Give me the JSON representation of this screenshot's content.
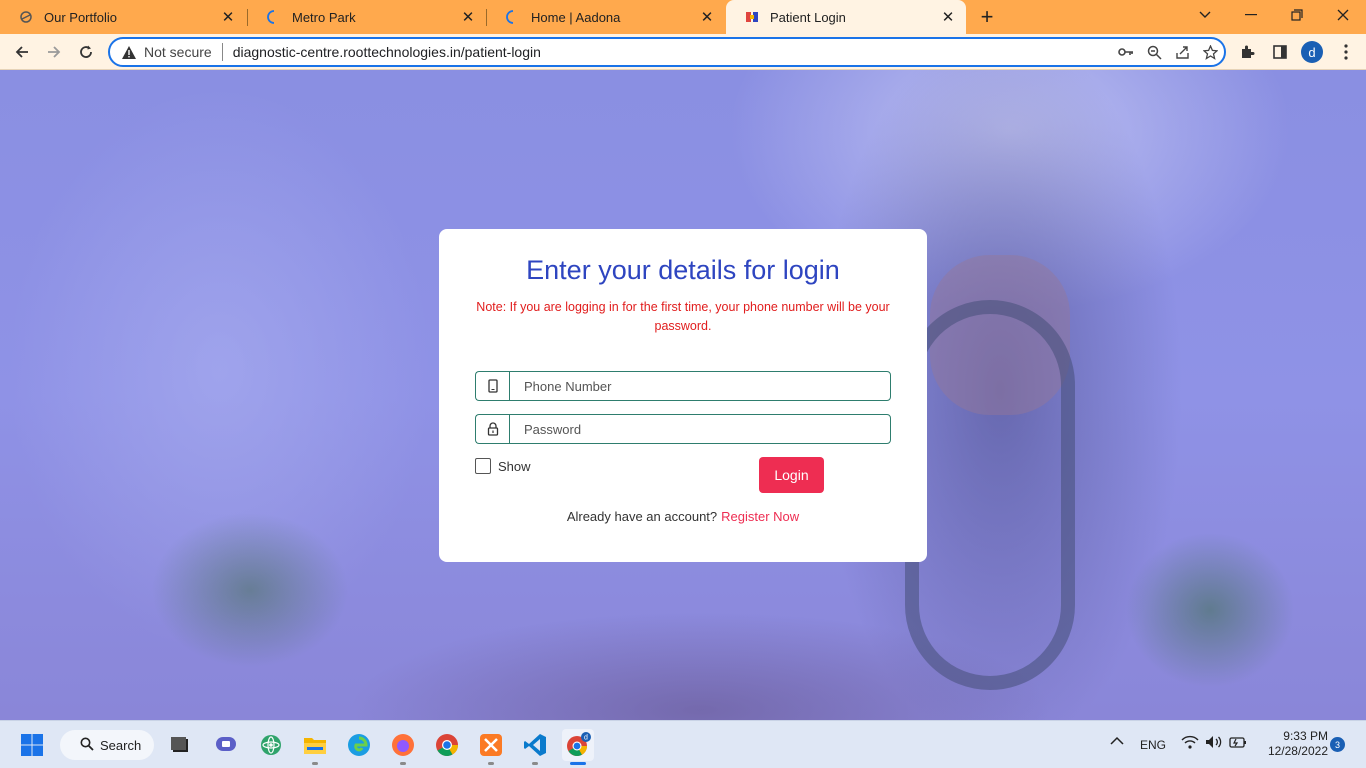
{
  "browser": {
    "tabs": [
      {
        "title": "Our Portfolio",
        "favicon": "portfolio-icon"
      },
      {
        "title": "Metro Park",
        "favicon": "loading-icon"
      },
      {
        "title": "Home | Aadona",
        "favicon": "loading-icon"
      },
      {
        "title": "Patient Login",
        "favicon": "clinic-icon"
      }
    ],
    "active_tab": 3,
    "security_label": "Not secure",
    "url": "diagnostic-centre.roottechnologies.in/patient-login",
    "profile_initial": "d"
  },
  "login": {
    "title": "Enter your details for login",
    "note": "Note: If you are logging in for the first time, your phone number will be your password.",
    "phone_placeholder": "Phone Number",
    "password_placeholder": "Password",
    "show_label": "Show",
    "show_checked": false,
    "login_label": "Login",
    "register_prompt": "Already have an account?",
    "register_link": "Register Now",
    "colors": {
      "title": "#2e45c0",
      "note": "#e11d1d",
      "accent": "#ee2d52"
    }
  },
  "taskbar": {
    "search_label": "Search",
    "language": "ENG",
    "time": "9:33 PM",
    "date": "12/28/2022",
    "notification_count": "3",
    "apps": [
      "start-icon",
      "search-icon",
      "task-view-icon",
      "teams-icon",
      "atom-icon",
      "file-explorer-icon",
      "edge-icon",
      "firefox-icon",
      "chrome-icon",
      "xampp-icon",
      "vscode-icon",
      "chrome-profile-icon"
    ]
  }
}
